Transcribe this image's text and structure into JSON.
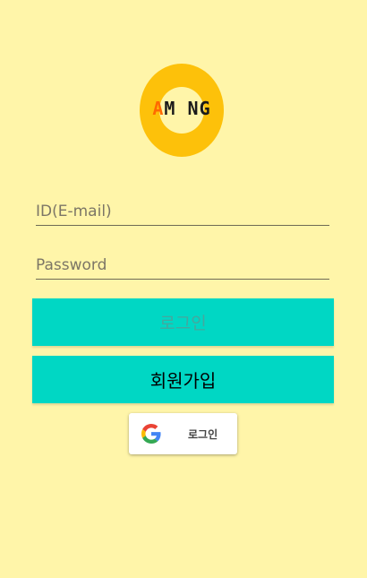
{
  "logo": {
    "letters": [
      "A",
      "M",
      "O",
      "N",
      "G"
    ]
  },
  "form": {
    "id_placeholder": "ID(E-mail)",
    "password_placeholder": "Password"
  },
  "buttons": {
    "login_label": "로그인",
    "signup_label": "회원가입",
    "google_label": "로그인"
  },
  "colors": {
    "background": "#fff5a9",
    "accent": "#00d7c4",
    "logo": "#fdc10a"
  },
  "icons": {
    "google": "google-icon"
  }
}
